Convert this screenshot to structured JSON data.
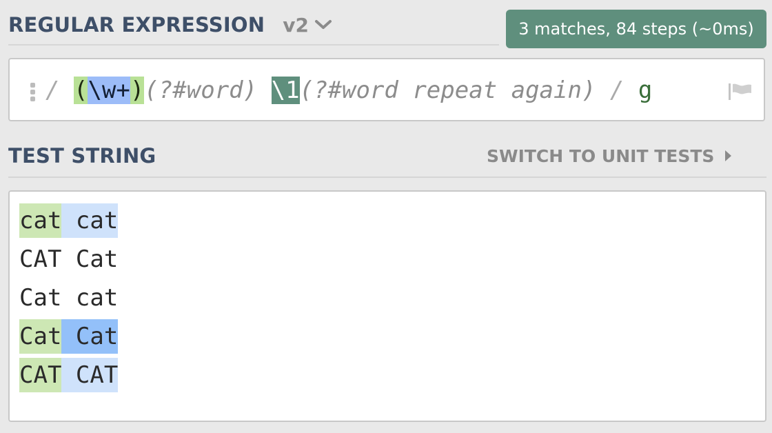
{
  "regex_panel": {
    "title": "REGULAR EXPRESSION",
    "version": "v2",
    "match_info": "3 matches, 84 steps (~0ms)",
    "expression": {
      "open_delim": "/",
      "group_open": "(",
      "char_class": "\\w+",
      "group_close": ")",
      "comment_1": "(?#word)",
      "space": " ",
      "backref": "\\1",
      "comment_2": "(?#word repeat again)",
      "close_delim": "/",
      "flags": "g"
    },
    "icons": {
      "handle": "drag-handle-icon",
      "version_toggle": "chevron-down-icon",
      "flags": "flag-icon"
    }
  },
  "test_panel": {
    "title": "TEST STRING",
    "switch_label": "SWITCH TO UNIT TESTS",
    "lines": [
      {
        "w1": "cat",
        "gap": " ",
        "w2": "cat",
        "matched": true
      },
      {
        "w1": "CAT",
        "gap": " ",
        "w2": "Cat",
        "matched": false
      },
      {
        "w1": "Cat",
        "gap": " ",
        "w2": "cat",
        "matched": false
      },
      {
        "w1": "Cat",
        "gap": " ",
        "w2": "Cat",
        "matched": true
      },
      {
        "w1": "CAT",
        "gap": " ",
        "w2": "CAT",
        "matched": true
      }
    ]
  },
  "colors": {
    "heading": "#3e4f68",
    "badge": "#5f8f7d",
    "group_highlight": "#b9e196",
    "class_highlight": "#9cbcf8",
    "match_first": "#cde7b4",
    "match_rest": "#cfe2fb"
  }
}
